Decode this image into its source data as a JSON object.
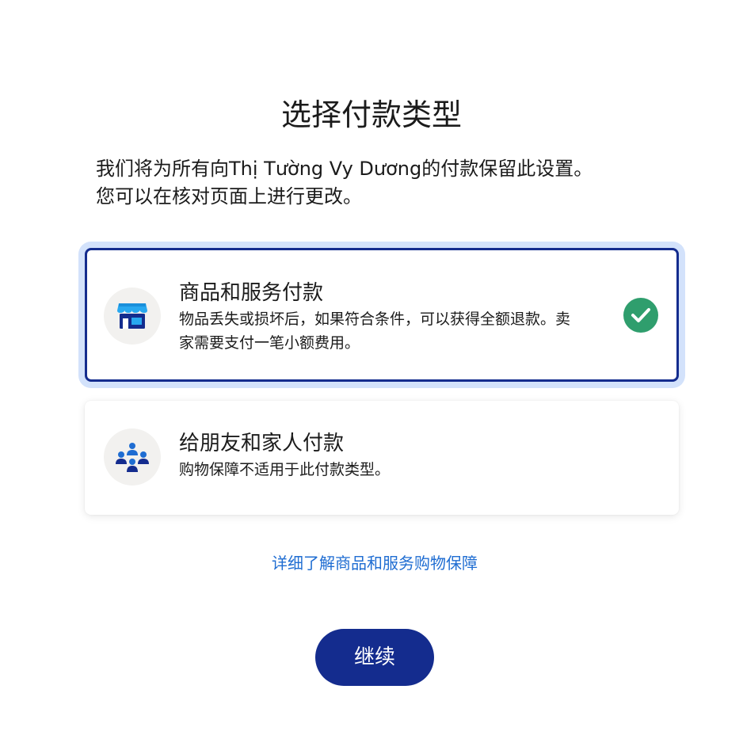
{
  "page": {
    "title": "选择付款类型",
    "description_line1": "我们将为所有向Thị Tường Vy Dương的付款保留此设置。",
    "description_line2": "您可以在核对页面上进行更改。"
  },
  "options": [
    {
      "title": "商品和服务付款",
      "subtitle": "物品丢失或损坏后，如果符合条件，可以获得全额退款。卖家需要支付一笔小额费用。",
      "icon": "storefront-icon",
      "selected": true
    },
    {
      "title": "给朋友和家人付款",
      "subtitle": "购物保障不适用于此付款类型。",
      "icon": "people-group-icon",
      "selected": false
    }
  ],
  "learn_more_link": "详细了解商品和服务购物保障",
  "continue_button": "继续",
  "colors": {
    "primary": "#142c8e",
    "selected_glow": "#d3e2fb",
    "check_green": "#2f9e6d",
    "link_blue": "#1f6dd2",
    "icon_bg": "#f2f1ef"
  }
}
